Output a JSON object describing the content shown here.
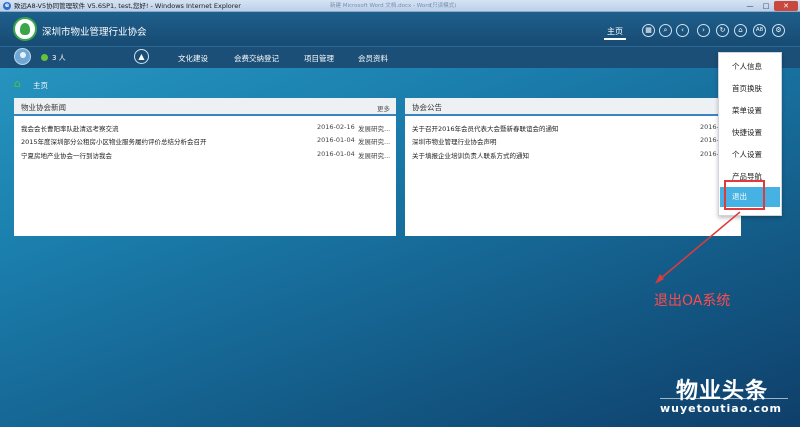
{
  "browser": {
    "title": "致远A8-V5协同管理软件 V5.6SP1, test,您好! - Windows Internet Explorer",
    "background_tabs": [
      "新建 Microsoft Word 文档.docx - Word",
      "(只读模式)"
    ],
    "controls": {
      "minimize": "—",
      "maximize": "□",
      "close": "✕"
    }
  },
  "header": {
    "org_name": "深圳市物业管理行业协会",
    "home_label": "主页",
    "icons": [
      "grid-icon",
      "search-icon",
      "back-icon",
      "forward-icon",
      "refresh-icon",
      "home-icon",
      "a8-icon",
      "settings-icon"
    ],
    "a8_text": "A8"
  },
  "navbar": {
    "online_count": "3 人",
    "items": [
      {
        "label": "文化建设"
      },
      {
        "label": "会费交纳登记"
      },
      {
        "label": "项目管理"
      },
      {
        "label": "会员资料"
      }
    ]
  },
  "breadcrumb": {
    "label": "主页"
  },
  "news_panel": {
    "title": "物业协会新闻",
    "more": "更多",
    "rows": [
      {
        "title": "我会会长曹阳率队赴清远考察交流",
        "date": "2016-02-16",
        "sender": "发展研究..."
      },
      {
        "title": "2015年度深圳部分公租房小区物业服务履约评价总结分析会召开",
        "date": "2016-01-04",
        "sender": "发展研究..."
      },
      {
        "title": "宁夏房地产业协会一行到访我会",
        "date": "2016-01-04",
        "sender": "发展研究..."
      }
    ]
  },
  "notice_panel": {
    "title": "协会公告",
    "rows": [
      {
        "title": "关于召开2016年会员代表大会暨新春联谊会的通知",
        "date": "2016-"
      },
      {
        "title": "深圳市物业管理行业协会声明",
        "date": "2016-"
      },
      {
        "title": "关于填报企业培训负责人联系方式的通知",
        "date": "2016-"
      }
    ]
  },
  "user_menu": {
    "items": [
      {
        "label": "个人信息"
      },
      {
        "label": "首页换肤"
      },
      {
        "label": "菜单设置"
      },
      {
        "label": "快捷设置"
      },
      {
        "label": "个人设置"
      },
      {
        "label": "产品导航"
      },
      {
        "label": "退出"
      }
    ]
  },
  "annotation": {
    "text": "退出OA系统",
    "color": "#ff4b4b"
  },
  "watermark": {
    "main": "物业头条",
    "url": "wuyetoutiao.com"
  },
  "colors": {
    "accent": "#46b2e3",
    "header": "#1e5f8c",
    "panel_rule": "#3b84c4"
  }
}
